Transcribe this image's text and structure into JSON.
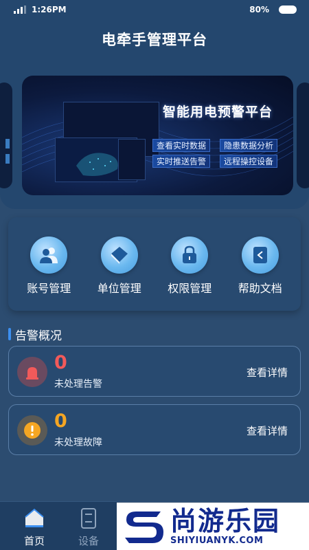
{
  "status_bar": {
    "time": "1:26PM",
    "battery": "80%"
  },
  "header": {
    "title": "电牵手管理平台"
  },
  "banner": {
    "title": "智能用电预警平台",
    "tags": [
      "查看实时数据",
      "隐患数据分析",
      "实时推送告警",
      "远程操控设备"
    ]
  },
  "menu": {
    "items": [
      {
        "label": "账号管理",
        "icon": "users-icon"
      },
      {
        "label": "单位管理",
        "icon": "book-icon"
      },
      {
        "label": "权限管理",
        "icon": "lock-icon"
      },
      {
        "label": "帮助文档",
        "icon": "document-icon"
      }
    ]
  },
  "alerts": {
    "section_title": "告警概况",
    "cards": [
      {
        "count": "0",
        "label": "未处理告警",
        "link": "查看详情",
        "icon": "siren-icon",
        "color": "#f25a5a"
      },
      {
        "count": "0",
        "label": "未处理故障",
        "link": "查看详情",
        "icon": "warning-icon",
        "color": "#f5a623"
      }
    ]
  },
  "bottom_nav": {
    "items": [
      {
        "label": "首页",
        "icon": "home-icon",
        "active": true
      },
      {
        "label": "设备",
        "icon": "device-icon",
        "active": false
      }
    ]
  },
  "watermark": {
    "cn": "尚游乐园",
    "en": "SHIYIUANYK.COM"
  },
  "colors": {
    "accent": "#3c8ff0",
    "alarm": "#f25a5a",
    "fault": "#f5a623",
    "background": "#2c4c70"
  }
}
